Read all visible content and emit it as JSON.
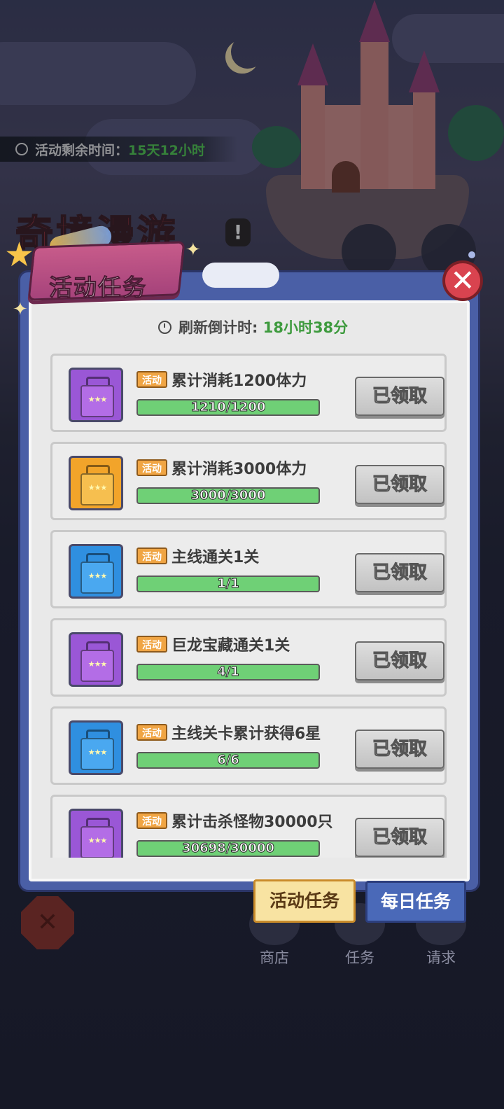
{
  "activity_timer": {
    "label": "活动剩余时间：",
    "value": "15天12小时"
  },
  "game_title": "奇境漫游",
  "modal": {
    "title": "活动任务",
    "refresh_label": "刷新倒计时: ",
    "refresh_value": "18小时38分"
  },
  "tasks": [
    {
      "tag": "活动",
      "title": "累计消耗1200体力",
      "progress": "1210/1200",
      "button": "已领取",
      "chest": "purple-chest-icon"
    },
    {
      "tag": "活动",
      "title": "累计消耗3000体力",
      "progress": "3000/3000",
      "button": "已领取",
      "chest": "gold-chest-icon"
    },
    {
      "tag": "活动",
      "title": "主线通关1关",
      "progress": "1/1",
      "button": "已领取",
      "chest": "blue-chest-icon"
    },
    {
      "tag": "活动",
      "title": "巨龙宝藏通关1关",
      "progress": "4/1",
      "button": "已领取",
      "chest": "purple-chest-icon"
    },
    {
      "tag": "活动",
      "title": "主线关卡累计获得6星",
      "progress": "6/6",
      "button": "已领取",
      "chest": "blue-chest-icon"
    },
    {
      "tag": "活动",
      "title": "累计击杀怪物30000只",
      "progress": "30698/30000",
      "button": "已领取",
      "chest": "purple-chest-icon"
    }
  ],
  "tabs": {
    "active": "活动任务",
    "inactive": "每日任务"
  },
  "bottom_nav": [
    "商店",
    "任务",
    "请求"
  ],
  "colors": {
    "purple_chest": "#9a57d6",
    "gold_chest": "#f2a42a",
    "blue_chest": "#2f8fe0",
    "progress": "#6fd076"
  }
}
